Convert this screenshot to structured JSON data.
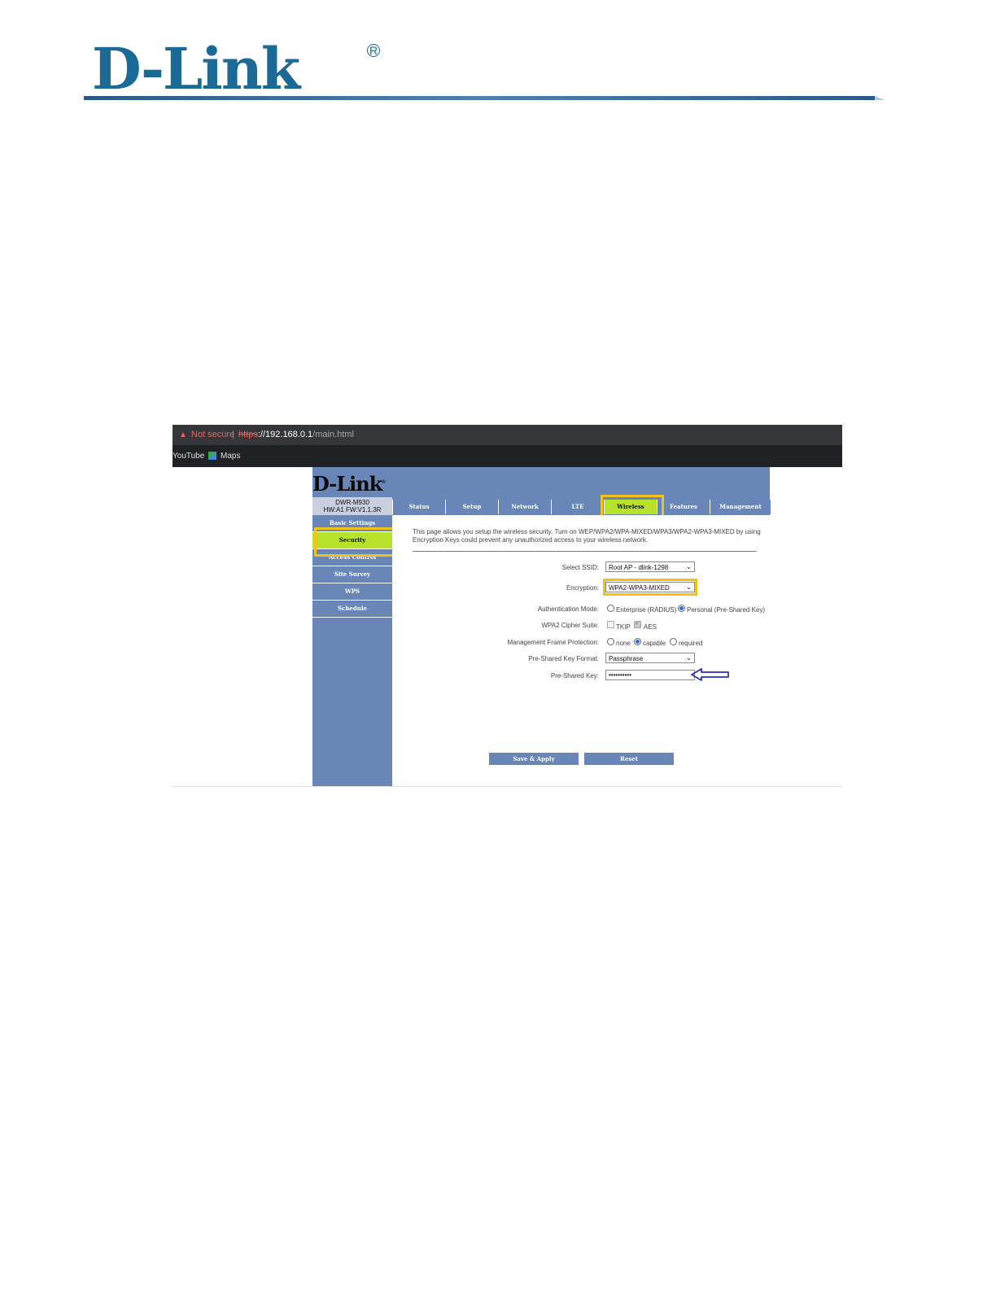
{
  "document": {
    "logo": "D-Link",
    "logo_mark": "R"
  },
  "browser": {
    "security_label": "Not secure",
    "url_protocol": "https",
    "url_host": "192.168.0.1",
    "url_path": "/main.html",
    "bookmarks": [
      "YouTube",
      "Maps"
    ]
  },
  "router": {
    "brand": "D-Link",
    "brand_mark": "®",
    "model_line1": "DWR-M930",
    "model_line2": "HW:A1   FW:V1.1.3R",
    "tabs": [
      "Status",
      "Setup",
      "Network",
      "LTE",
      "Wireless",
      "Features",
      "Management"
    ],
    "active_tab": "Wireless",
    "sidebar": [
      "Basic Settings",
      "Security",
      "Access Control",
      "Site Survey",
      "WPS",
      "Schedule"
    ],
    "active_sidebar": "Security",
    "description": "This page allows you setup the wireless security. Turn on WEP/WPA2/WPA-MIXED/WPA3/WPA2-WPA3-MIXED by using Encryption Keys could prevent any unauthorized access to your wireless network.",
    "form": {
      "ssid_label": "Select SSID:",
      "ssid_value": "Root AP - dlink-1298",
      "encryption_label": "Encryption:",
      "encryption_value": "WPA2-WPA3-MIXED",
      "auth_label": "Authentication Mode:",
      "auth_enterprise": "Enterprise (RADIUS)",
      "auth_personal": "Personal (Pre-Shared Key)",
      "cipher_label": "WPA2 Cipher Suite:",
      "cipher_tkip": "TKIP",
      "cipher_aes": "AES",
      "mfp_label": "Management Frame Protection:",
      "mfp_none": "none",
      "mfp_capable": "capable",
      "mfp_required": "required",
      "psk_format_label": "Pre-Shared Key Format:",
      "psk_format_value": "Passphrase",
      "psk_label": "Pre-Shared Key:",
      "psk_value": "••••••••••"
    },
    "buttons": {
      "save": "Save & Apply",
      "reset": "Reset"
    }
  },
  "colors": {
    "router_blue": "#6886b7",
    "active_green": "#b6e22a",
    "highlight_yellow": "#f2c21a",
    "arrow_blue": "#2f2fb5",
    "logo_blue": "#1b6a95"
  }
}
